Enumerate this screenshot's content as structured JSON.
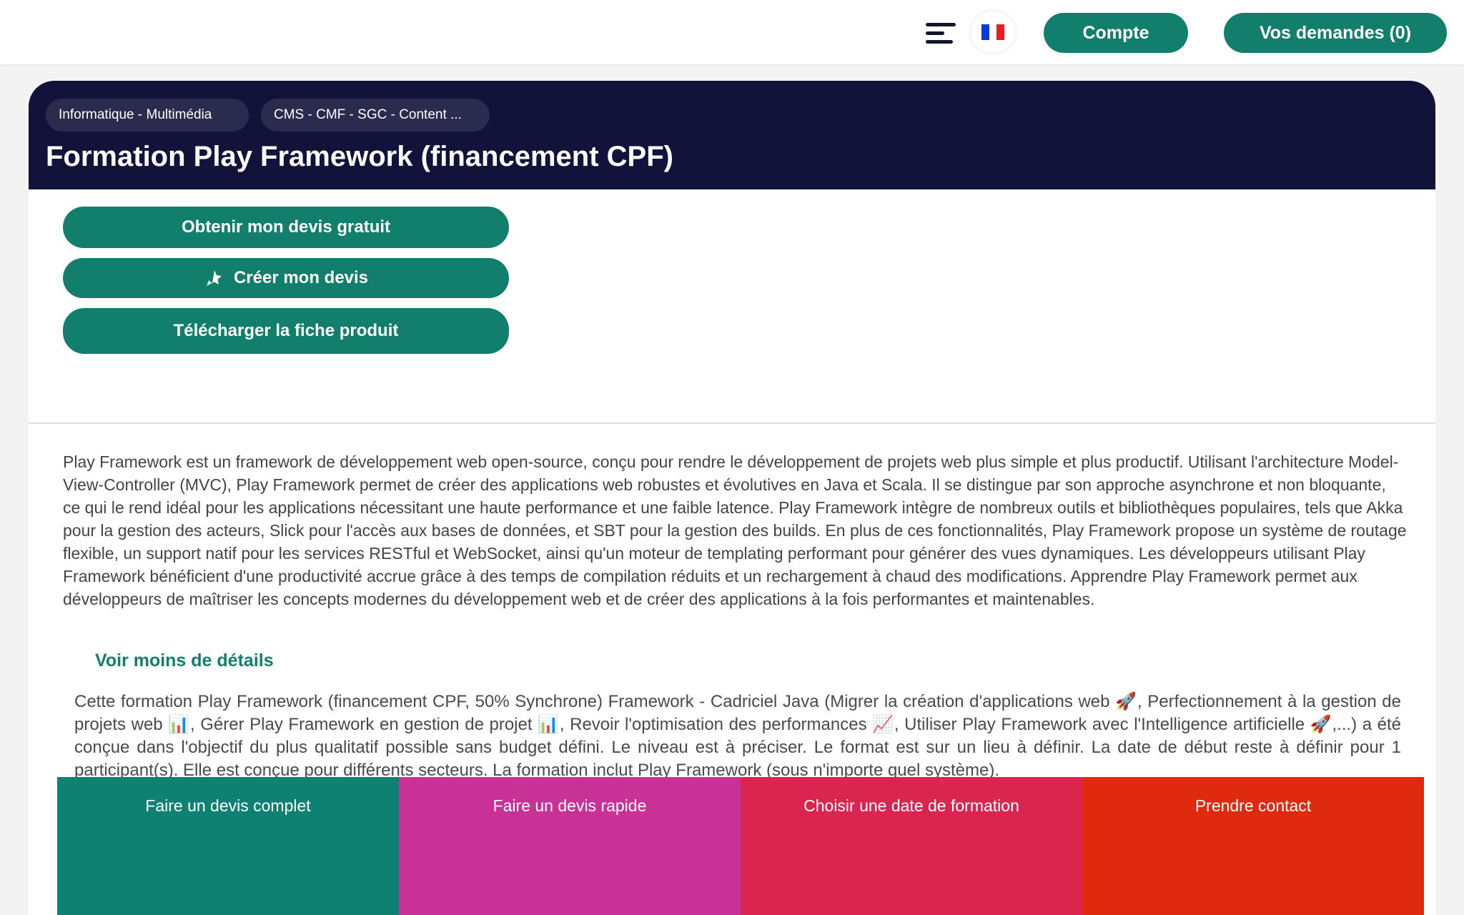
{
  "header": {
    "account_label": "Compte",
    "requests_label": "Vos demandes (0)",
    "language_flag_colors": [
      "#0b3bd6",
      "#ffffff",
      "#e3201d"
    ]
  },
  "breadcrumbs": [
    "Informatique - Multimédia",
    "CMS - CMF - SGC - Content ..."
  ],
  "title": "Formation Play Framework (financement CPF)",
  "actions": {
    "quote_free": "Obtenir mon devis gratuit",
    "create_quote": "Créer mon devis",
    "download_sheet": "Télécharger la fiche produit"
  },
  "description": "Play Framework est un framework de développement web open-source, conçu pour rendre le développement de projets web plus simple et plus productif. Utilisant l'architecture Model-View-Controller (MVC), Play Framework permet de créer des applications web robustes et évolutives en Java et Scala. Il se distingue par son approche asynchrone et non bloquante, ce qui le rend idéal pour les applications nécessitant une haute performance et une faible latence. Play Framework intègre de nombreux outils et bibliothèques populaires, tels que Akka pour la gestion des acteurs, Slick pour l'accès aux bases de données, et SBT pour la gestion des builds. En plus de ces fonctionnalités, Play Framework propose un système de routage flexible, un support natif pour les services RESTful et WebSocket, ainsi qu'un moteur de templating performant pour générer des vues dynamiques. Les développeurs utilisant Play Framework bénéficient d'une productivité accrue grâce à des temps de compilation réduits et un rechargement à chaud des modifications. Apprendre Play Framework permet aux développeurs de maîtriser les concepts modernes du développement web et de créer des applications à la fois performantes et maintenables.",
  "toggle_details": "Voir moins de détails",
  "summary": "Cette formation Play Framework (financement CPF, 50% Synchrone) Framework - Cadriciel Java (Migrer la création d'applications web 🚀, Perfectionnement à la gestion de projets web 📊, Gérer Play Framework en gestion de projet 📊, Revoir l'optimisation des performances 📈, Utiliser Play Framework avec l'Intelligence artificielle 🚀,...) a été conçue dans l'objectif du plus qualitatif possible sans budget défini. Le niveau est à préciser. Le format est sur un lieu à définir. La date de début reste à définir pour 1 participant(s). Elle est conçue pour différents secteurs. La formation inclut Play Framework (sous n'importe quel système).",
  "cta": [
    {
      "label": "Faire un devis complet",
      "color": "#0f8173"
    },
    {
      "label": "Faire un devis rapide",
      "color": "#c83296"
    },
    {
      "label": "Choisir une date de formation",
      "color": "#da2550"
    },
    {
      "label": "Prendre contact",
      "color": "#e02a10"
    }
  ],
  "colors": {
    "accent": "#127f6c",
    "header_bg": "#12133a"
  }
}
